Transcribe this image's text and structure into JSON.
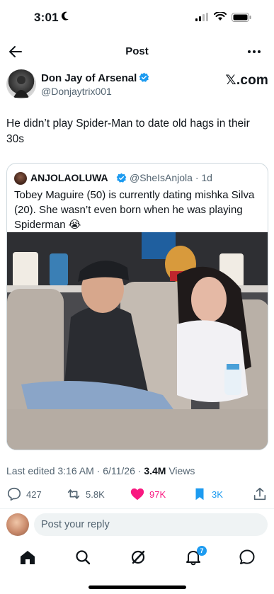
{
  "status_bar": {
    "time": "3:01"
  },
  "nav": {
    "title": "Post"
  },
  "author": {
    "name": "Don Jay of Arsenal",
    "handle": "@Donjaytrix001",
    "source": "𝕏.com"
  },
  "tweet": {
    "text": "He didn’t play  Spider-Man to date old hags in their 30s"
  },
  "quoted": {
    "name": "ANJOLAOLUWA",
    "handle_time": "@SheIsAnjola · 1d",
    "text": "Tobey Maguire (50) is currently dating mishka Silva (20). She wasn’t even born when he was playing Spiderman 😭"
  },
  "meta": {
    "edited": "Last edited 3:16 AM · 6/11/26 · ",
    "views_count": "3.4M",
    "views_label": " Views"
  },
  "actions": {
    "replies": "427",
    "reposts": "5.8K",
    "likes": "97K",
    "bookmarks": "3K"
  },
  "reply": {
    "placeholder": "Post your reply"
  },
  "tabbar": {
    "notification_count": "7"
  },
  "colors": {
    "accent": "#1d9bf0",
    "like": "#f91880",
    "muted": "#536471"
  }
}
